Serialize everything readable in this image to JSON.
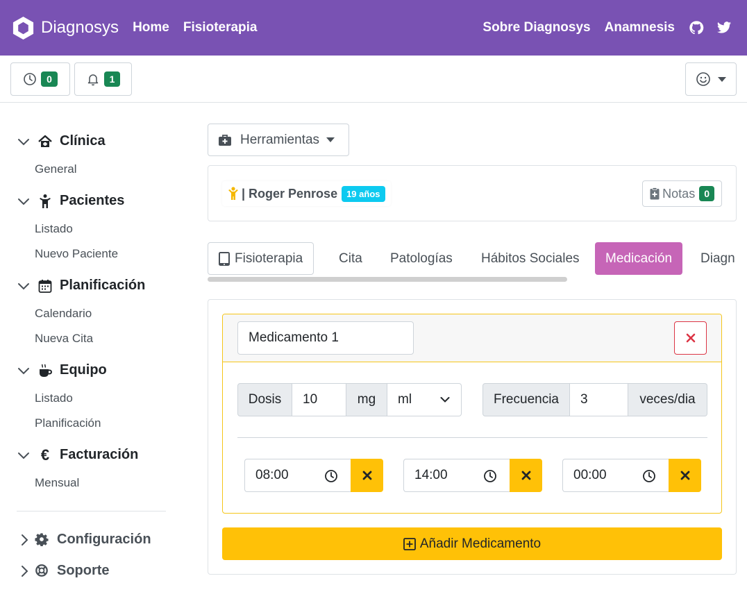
{
  "navbar": {
    "brand": "Diagnosys",
    "links": [
      "Home",
      "Fisioterapia"
    ],
    "right_links": [
      "Sobre Diagnosys",
      "Anamnesis"
    ],
    "icons": [
      "github-icon",
      "twitter-icon"
    ],
    "color": "#7952b3"
  },
  "toolbar": {
    "history_count": "0",
    "notifications_count": "1",
    "user_menu_icon": "smiley-icon"
  },
  "sidebar": {
    "sections": [
      {
        "label": "Clínica",
        "icon": "home-icon",
        "items": [
          "General"
        ]
      },
      {
        "label": "Pacientes",
        "icon": "person-icon",
        "items": [
          "Listado",
          "Nuevo Paciente"
        ]
      },
      {
        "label": "Planificación",
        "icon": "calendar-icon",
        "items": [
          "Calendario",
          "Nueva Cita"
        ]
      },
      {
        "label": "Equipo",
        "icon": "coffee-icon",
        "items": [
          "Listado",
          "Planificación"
        ]
      },
      {
        "label": "Facturación",
        "icon": "euro-icon",
        "items": [
          "Mensual"
        ]
      }
    ],
    "footer": [
      {
        "label": "Configuración",
        "icon": "gear-icon"
      },
      {
        "label": "Soporte",
        "icon": "lifebuoy-icon"
      }
    ]
  },
  "main": {
    "tools_label": "Herramientas",
    "patient": {
      "name": "| Roger Penrose",
      "age": "19 años",
      "notes_label": "Notas",
      "notes_count": "0"
    },
    "tabs": [
      "Fisioterapia",
      "Cita",
      "Patologías",
      "Hábitos Sociales",
      "Medicación",
      "Diagn"
    ],
    "active_tab": "Medicación",
    "active_tab_color": "#c665b7",
    "medication": {
      "name": "Medicamento 1",
      "dose_label": "Dosis",
      "dose_value": "10",
      "dose_unit": "mg",
      "dose_unit_select": "ml",
      "frequency_label": "Frecuencia",
      "frequency_value": "3",
      "frequency_unit": "veces/dia",
      "times": [
        "08:00",
        "14:00",
        "00:00"
      ]
    },
    "add_label": "Añadir Medicamento",
    "accent": "#ffc107"
  }
}
